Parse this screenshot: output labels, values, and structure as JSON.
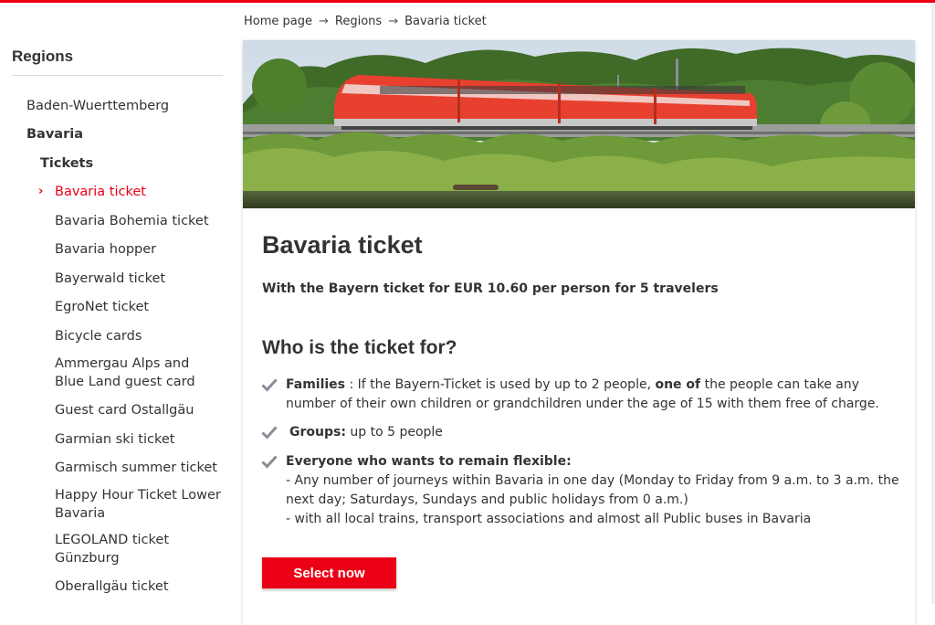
{
  "breadcrumb": {
    "items": [
      "Home page",
      "Regions",
      "Bavaria ticket"
    ],
    "separator": "→"
  },
  "sidebar": {
    "title": "Regions",
    "items": [
      {
        "label": "Baden-Wuerttemberg",
        "level": 1
      },
      {
        "label": "Bavaria",
        "level": 1,
        "bold": true
      },
      {
        "label": "Tickets",
        "level": 2,
        "bold": true
      },
      {
        "label": "Bavaria ticket",
        "level": 3,
        "active": true
      },
      {
        "label": "Bavaria Bohemia ticket",
        "level": 3
      },
      {
        "label": "Bavaria hopper",
        "level": 3
      },
      {
        "label": "Bayerwald ticket",
        "level": 3
      },
      {
        "label": "EgroNet ticket",
        "level": 3
      },
      {
        "label": "Bicycle cards",
        "level": 3
      },
      {
        "label": "Ammergau Alps and Blue Land guest card",
        "level": 3
      },
      {
        "label": "Guest card Ostallgäu",
        "level": 3
      },
      {
        "label": "Garmian ski ticket",
        "level": 3
      },
      {
        "label": "Garmisch summer ticket",
        "level": 3
      },
      {
        "label": "Happy Hour Ticket Lower Bavaria",
        "level": 3
      },
      {
        "label": "LEGOLAND ticket Günzburg",
        "level": 3
      },
      {
        "label": "Oberallgäu ticket",
        "level": 3
      }
    ],
    "active_chevron": "›"
  },
  "main": {
    "title": "Bavaria ticket",
    "subtitle": "With the Bayern ticket for EUR 10.60 per person for 5 travelers",
    "section_title": "Who is the ticket for?",
    "features": [
      {
        "heading": "Families",
        "text_before": " : If the Bayern-Ticket is used by up to 2 people, ",
        "emphasis": "one of",
        "text_after": " the people can take any number of their own children or grandchildren under the age of 15 with them free of charge."
      },
      {
        "heading": "Groups:",
        "text_after": " up to 5 people"
      },
      {
        "heading": "Everyone who wants to remain flexible:",
        "line1": "- Any number of journeys within Bavaria in one day (Monday to Friday from 9 a.m. to 3 a.m. the next day; Saturdays, Sundays and public holidays from 0 a.m.)",
        "line2": "- with all local trains, transport associations and almost all Public buses in Bavaria"
      }
    ],
    "cta_label": "Select now"
  },
  "icons": {
    "feature_check": "check-icon",
    "breadcrumb_separator": "arrow-right-icon"
  },
  "colors": {
    "accent": "#ec0016",
    "text": "#333333",
    "check": "#878c96"
  }
}
